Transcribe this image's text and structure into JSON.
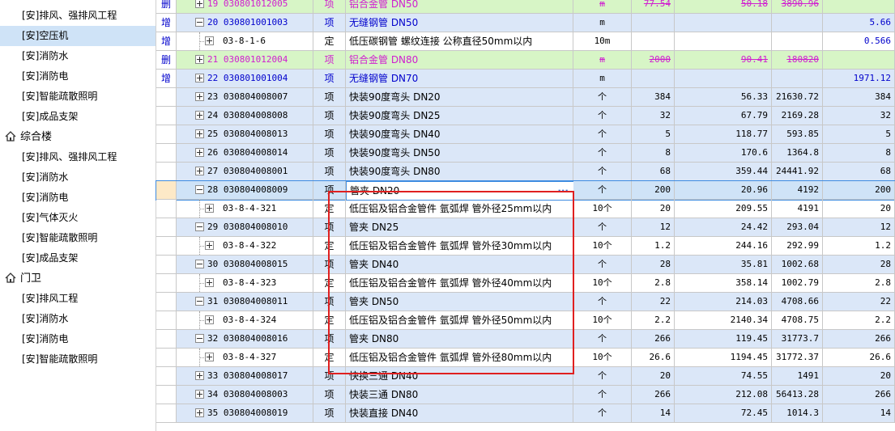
{
  "tree": {
    "items": [
      {
        "label": "[安]排风、强排风工程",
        "type": "child"
      },
      {
        "label": "[安]空压机",
        "type": "child",
        "selected": true
      },
      {
        "label": "[安]消防水",
        "type": "child"
      },
      {
        "label": "[安]消防电",
        "type": "child"
      },
      {
        "label": "[安]智能疏散照明",
        "type": "child"
      },
      {
        "label": "[安]成品支架",
        "type": "child"
      },
      {
        "label": "综合楼",
        "type": "group"
      },
      {
        "label": "[安]排风、强排风工程",
        "type": "child"
      },
      {
        "label": "[安]消防水",
        "type": "child"
      },
      {
        "label": "[安]消防电",
        "type": "child"
      },
      {
        "label": "[安]气体灭火",
        "type": "child"
      },
      {
        "label": "[安]智能疏散照明",
        "type": "child"
      },
      {
        "label": "[安]成品支架",
        "type": "child"
      },
      {
        "label": "门卫",
        "type": "group"
      },
      {
        "label": "[安]排风工程",
        "type": "child"
      },
      {
        "label": "[安]消防水",
        "type": "child"
      },
      {
        "label": "[安]消防电",
        "type": "child"
      },
      {
        "label": "[安]智能疏散照明",
        "type": "child"
      }
    ]
  },
  "grid": {
    "rows": [
      {
        "mark": "删",
        "num": "19",
        "code": "030801012005",
        "cat": "项",
        "name": "铝合金管 DN50",
        "unit": "m",
        "qty": "77.54",
        "price": "50.18",
        "total": "3890.96",
        "last": "",
        "style": "del",
        "level": "parent"
      },
      {
        "mark": "增",
        "num": "20",
        "code": "030801001003",
        "cat": "项",
        "name": "无缝钢管 DN50",
        "unit": "m",
        "qty": "",
        "price": "",
        "total": "",
        "last": "5.66",
        "style": "blue add",
        "level": "parent",
        "expanded": true
      },
      {
        "mark": "增",
        "num": "",
        "code": "03-8-1-6",
        "cat": "定",
        "name": "低压碳钢管 螺纹连接 公称直径50mm以内",
        "unit": "10m",
        "qty": "",
        "price": "",
        "total": "",
        "last": "0.566",
        "style": "add",
        "level": "child"
      },
      {
        "mark": "删",
        "num": "21",
        "code": "030801012004",
        "cat": "项",
        "name": "铝合金管 DN80",
        "unit": "m",
        "qty": "2000",
        "price": "90.41",
        "total": "180820",
        "last": "",
        "style": "del",
        "level": "parent"
      },
      {
        "mark": "增",
        "num": "22",
        "code": "030801001004",
        "cat": "项",
        "name": "无缝钢管 DN70",
        "unit": "m",
        "qty": "",
        "price": "",
        "total": "",
        "last": "1971.12",
        "style": "blue add",
        "level": "parent"
      },
      {
        "mark": "",
        "num": "23",
        "code": "030804008007",
        "cat": "项",
        "name": "快装90度弯头 DN20",
        "unit": "个",
        "qty": "384",
        "price": "56.33",
        "total": "21630.72",
        "last": "384",
        "style": "blue",
        "level": "parent"
      },
      {
        "mark": "",
        "num": "24",
        "code": "030804008008",
        "cat": "项",
        "name": "快装90度弯头 DN25",
        "unit": "个",
        "qty": "32",
        "price": "67.79",
        "total": "2169.28",
        "last": "32",
        "style": "blue",
        "level": "parent"
      },
      {
        "mark": "",
        "num": "25",
        "code": "030804008013",
        "cat": "项",
        "name": "快装90度弯头 DN40",
        "unit": "个",
        "qty": "5",
        "price": "118.77",
        "total": "593.85",
        "last": "5",
        "style": "blue",
        "level": "parent"
      },
      {
        "mark": "",
        "num": "26",
        "code": "030804008014",
        "cat": "项",
        "name": "快装90度弯头 DN50",
        "unit": "个",
        "qty": "8",
        "price": "170.6",
        "total": "1364.8",
        "last": "8",
        "style": "blue",
        "level": "parent"
      },
      {
        "mark": "",
        "num": "27",
        "code": "030804008001",
        "cat": "项",
        "name": "快装90度弯头 DN80",
        "unit": "个",
        "qty": "68",
        "price": "359.44",
        "total": "24441.92",
        "last": "68",
        "style": "blue",
        "level": "parent"
      },
      {
        "mark": "",
        "num": "28",
        "code": "030804008009",
        "cat": "项",
        "name": "管夹 DN20",
        "unit": "个",
        "qty": "200",
        "price": "20.96",
        "total": "4192",
        "last": "200",
        "style": "blue cur",
        "level": "parent",
        "expanded": true
      },
      {
        "mark": "",
        "num": "",
        "code": "03-8-4-321",
        "cat": "定",
        "name": "低压铝及铝合金管件 氩弧焊 管外径25mm以内",
        "unit": "10个",
        "qty": "20",
        "price": "209.55",
        "total": "4191",
        "last": "20",
        "style": "",
        "level": "child"
      },
      {
        "mark": "",
        "num": "29",
        "code": "030804008010",
        "cat": "项",
        "name": "管夹 DN25",
        "unit": "个",
        "qty": "12",
        "price": "24.42",
        "total": "293.04",
        "last": "12",
        "style": "blue",
        "level": "parent",
        "expanded": true
      },
      {
        "mark": "",
        "num": "",
        "code": "03-8-4-322",
        "cat": "定",
        "name": "低压铝及铝合金管件 氩弧焊 管外径30mm以内",
        "unit": "10个",
        "qty": "1.2",
        "price": "244.16",
        "total": "292.99",
        "last": "1.2",
        "style": "",
        "level": "child"
      },
      {
        "mark": "",
        "num": "30",
        "code": "030804008015",
        "cat": "项",
        "name": "管夹 DN40",
        "unit": "个",
        "qty": "28",
        "price": "35.81",
        "total": "1002.68",
        "last": "28",
        "style": "blue",
        "level": "parent",
        "expanded": true
      },
      {
        "mark": "",
        "num": "",
        "code": "03-8-4-323",
        "cat": "定",
        "name": "低压铝及铝合金管件 氩弧焊 管外径40mm以内",
        "unit": "10个",
        "qty": "2.8",
        "price": "358.14",
        "total": "1002.79",
        "last": "2.8",
        "style": "",
        "level": "child"
      },
      {
        "mark": "",
        "num": "31",
        "code": "030804008011",
        "cat": "项",
        "name": "管夹 DN50",
        "unit": "个",
        "qty": "22",
        "price": "214.03",
        "total": "4708.66",
        "last": "22",
        "style": "blue",
        "level": "parent",
        "expanded": true
      },
      {
        "mark": "",
        "num": "",
        "code": "03-8-4-324",
        "cat": "定",
        "name": "低压铝及铝合金管件 氩弧焊 管外径50mm以内",
        "unit": "10个",
        "qty": "2.2",
        "price": "2140.34",
        "total": "4708.75",
        "last": "2.2",
        "style": "",
        "level": "child"
      },
      {
        "mark": "",
        "num": "32",
        "code": "030804008016",
        "cat": "项",
        "name": "管夹 DN80",
        "unit": "个",
        "qty": "266",
        "price": "119.45",
        "total": "31773.7",
        "last": "266",
        "style": "blue",
        "level": "parent",
        "expanded": true
      },
      {
        "mark": "",
        "num": "",
        "code": "03-8-4-327",
        "cat": "定",
        "name": "低压铝及铝合金管件 氩弧焊 管外径80mm以内",
        "unit": "10个",
        "qty": "26.6",
        "price": "1194.45",
        "total": "31772.37",
        "last": "26.6",
        "style": "",
        "level": "child"
      },
      {
        "mark": "",
        "num": "33",
        "code": "030804008017",
        "cat": "项",
        "name": "快换三通 DN40",
        "unit": "个",
        "qty": "20",
        "price": "74.55",
        "total": "1491",
        "last": "20",
        "style": "blue",
        "level": "parent"
      },
      {
        "mark": "",
        "num": "34",
        "code": "030804008003",
        "cat": "项",
        "name": "快装三通 DN80",
        "unit": "个",
        "qty": "266",
        "price": "212.08",
        "total": "56413.28",
        "last": "266",
        "style": "blue",
        "level": "parent"
      },
      {
        "mark": "",
        "num": "35",
        "code": "030804008019",
        "cat": "项",
        "name": "快装直接 DN40",
        "unit": "个",
        "qty": "14",
        "price": "72.45",
        "total": "1014.3",
        "last": "14",
        "style": "blue",
        "level": "parent"
      }
    ],
    "ellipsis_label": "···"
  },
  "colors": {
    "selected": "#cfe3f7",
    "item_row": "#dbe7f8",
    "deleted_row": "#d7f5c6",
    "deleted_text": "#d01ed0",
    "added_text": "#0000cc",
    "highlight_box": "#e02020"
  }
}
